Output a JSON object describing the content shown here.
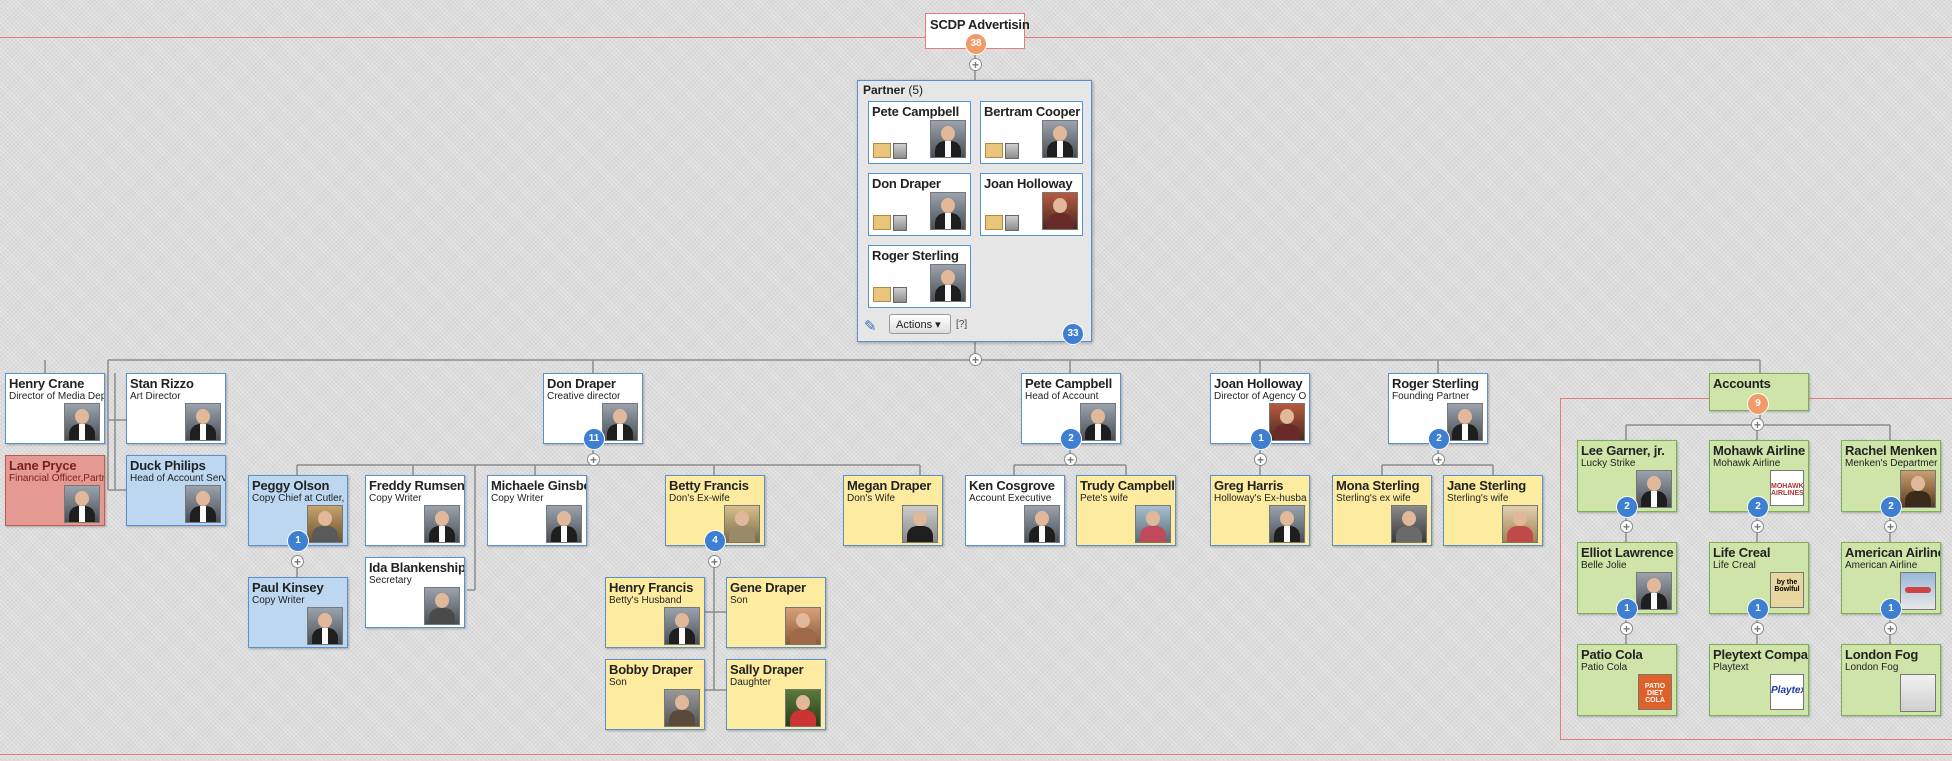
{
  "colors": {
    "accent_blue": "#3e7fd1",
    "region_border": "#e67c78",
    "card_yellow": "#fdeba0",
    "card_blue": "#bcd7ef",
    "card_green": "#cfe4a8",
    "card_red": "#e49a92"
  },
  "root": {
    "name": "SCDP Advertisin",
    "count": "38"
  },
  "partner": {
    "title": "Partner",
    "count": "(5)",
    "members": [
      "Pete Campbell",
      "Bertram Cooper",
      "Don Draper",
      "Joan Holloway",
      "Roger Sterling"
    ],
    "actions_label": "Actions",
    "help": "[?]",
    "total": "33"
  },
  "level1": {
    "henry": {
      "name": "Henry Crane",
      "role": "Director of Media Dep"
    },
    "stan": {
      "name": "Stan Rizzo",
      "role": "Art Director"
    },
    "lane": {
      "name": "Lane Pryce",
      "role": "Financial Officer,Partr"
    },
    "duck": {
      "name": "Duck Philips",
      "role": "Head of Account Serv"
    },
    "don": {
      "name": "Don Draper",
      "role": "Creative director",
      "count": "11"
    },
    "pete": {
      "name": "Pete Campbell",
      "role": "Head of Account",
      "count": "2"
    },
    "joan": {
      "name": "Joan Holloway",
      "role": "Director of Agency O",
      "count": "1"
    },
    "roger": {
      "name": "Roger Sterling",
      "role": "Founding Partner",
      "count": "2"
    },
    "accounts": {
      "name": "Accounts",
      "count": "9"
    }
  },
  "level2": {
    "peggy": {
      "name": "Peggy Olson",
      "role": "Copy Chief at Cutler,",
      "count": "1"
    },
    "paul": {
      "name": "Paul Kinsey",
      "role": "Copy Writer"
    },
    "freddy": {
      "name": "Freddy Rumsen",
      "role": "Copy Writer"
    },
    "ida": {
      "name": "Ida Blankenship",
      "role": "Secretary"
    },
    "michaele": {
      "name": "Michaele Ginsbe",
      "role": "Copy Writer"
    },
    "betty": {
      "name": "Betty Francis",
      "role": "Don's Ex-wife",
      "count": "4"
    },
    "megan": {
      "name": "Megan Draper",
      "role": "Don's Wife"
    },
    "henryf": {
      "name": "Henry Francis",
      "role": "Betty's Husband"
    },
    "gene": {
      "name": "Gene Draper",
      "role": "Son"
    },
    "bobby": {
      "name": "Bobby Draper",
      "role": "Son"
    },
    "sally": {
      "name": "Sally Draper",
      "role": "Daughter"
    },
    "ken": {
      "name": "Ken Cosgrove",
      "role": "Account Executive"
    },
    "trudy": {
      "name": "Trudy Campbell",
      "role": "Pete's wife"
    },
    "greg": {
      "name": "Greg Harris",
      "role": "Holloway's Ex-husba"
    },
    "mona": {
      "name": "Mona Sterling",
      "role": "Sterling's ex wife"
    },
    "jane": {
      "name": "Jane Sterling",
      "role": "Sterling's wife"
    }
  },
  "accounts": {
    "lee": {
      "name": "Lee Garner, jr.",
      "role": "Lucky Strike",
      "count": "2"
    },
    "mohawk": {
      "name": "Mohawk Airline",
      "role": "Mohawk Airline",
      "count": "2",
      "logo": "MOHAWK AIRLINES"
    },
    "rachel": {
      "name": "Rachel Menken",
      "role": "Menken's Departmer",
      "count": "2"
    },
    "elliot": {
      "name": "Elliot Lawrence",
      "role": "Belle Jolie",
      "count": "1"
    },
    "lifecreal": {
      "name": "Life Creal",
      "role": "Life Creal",
      "count": "1",
      "logo": "by the Bowlful"
    },
    "american": {
      "name": "American Airline",
      "role": "American Airline",
      "count": "1"
    },
    "patio": {
      "name": "Patio Cola",
      "role": "Patio Cola",
      "logo": "PATIO DIET COLA"
    },
    "playtext": {
      "name": "Pleytext Compar",
      "role": "Playtext",
      "logo": "Playtex"
    },
    "london": {
      "name": "London Fog",
      "role": "London Fog"
    }
  }
}
